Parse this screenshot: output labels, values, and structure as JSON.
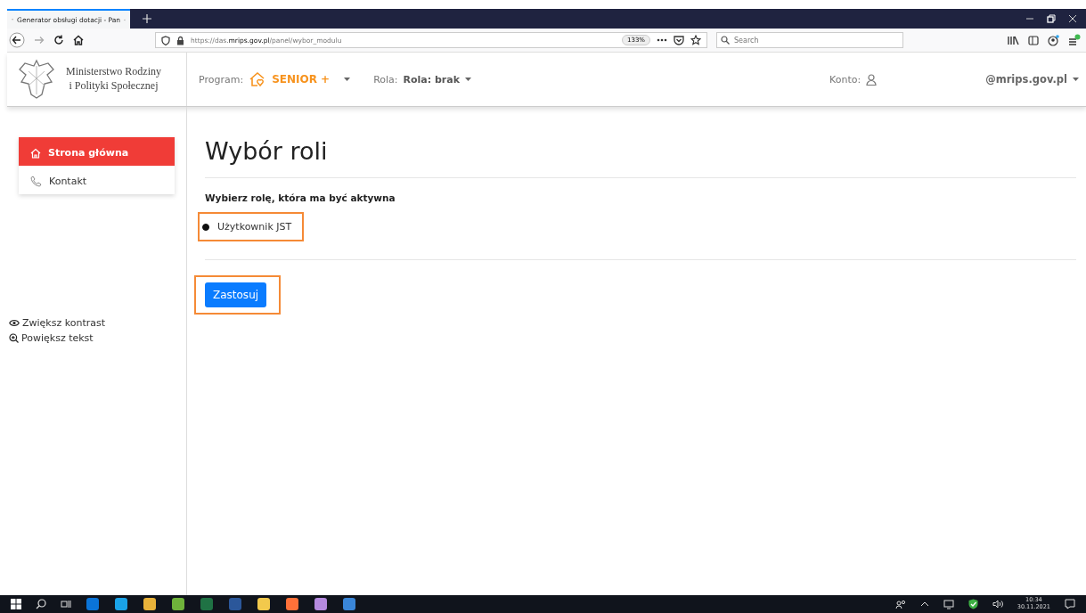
{
  "browser": {
    "tab_title": "Generator obsługi dotacji - Pan",
    "url_host": "https://das.",
    "url_domain": "mrips.gov.pl",
    "url_path": "/panel/wybor_modulu",
    "zoom": "133%",
    "search": {
      "placeholder": "Search"
    }
  },
  "header": {
    "ministry": [
      "Ministerstwo Rodziny",
      "i Polityki Społecznej"
    ],
    "program_label": "Program:",
    "program_value": "SENIOR +",
    "role_label": "Rola:",
    "role_value": "Rola: brak",
    "account_label": "Konto:",
    "account_email": "@mrips.gov.pl"
  },
  "sidebar": {
    "items": [
      {
        "label": "Strona główna",
        "kind": "home",
        "selected": true
      },
      {
        "label": "Kontakt",
        "kind": "phone",
        "selected": false
      }
    ],
    "tools": [
      {
        "label": "Zwiększ kontrast",
        "kind": "contrast"
      },
      {
        "label": "Powiększ tekst",
        "kind": "zoom"
      }
    ]
  },
  "main": {
    "title": "Wybór roli",
    "prompt": "Wybierz rolę, która ma być aktywna",
    "options": [
      {
        "label": "Użytkownik JST",
        "selected": true
      }
    ],
    "apply_button": "Zastosuj"
  },
  "taskbar": {
    "time": "10:34",
    "date": "30.11.2021"
  }
}
